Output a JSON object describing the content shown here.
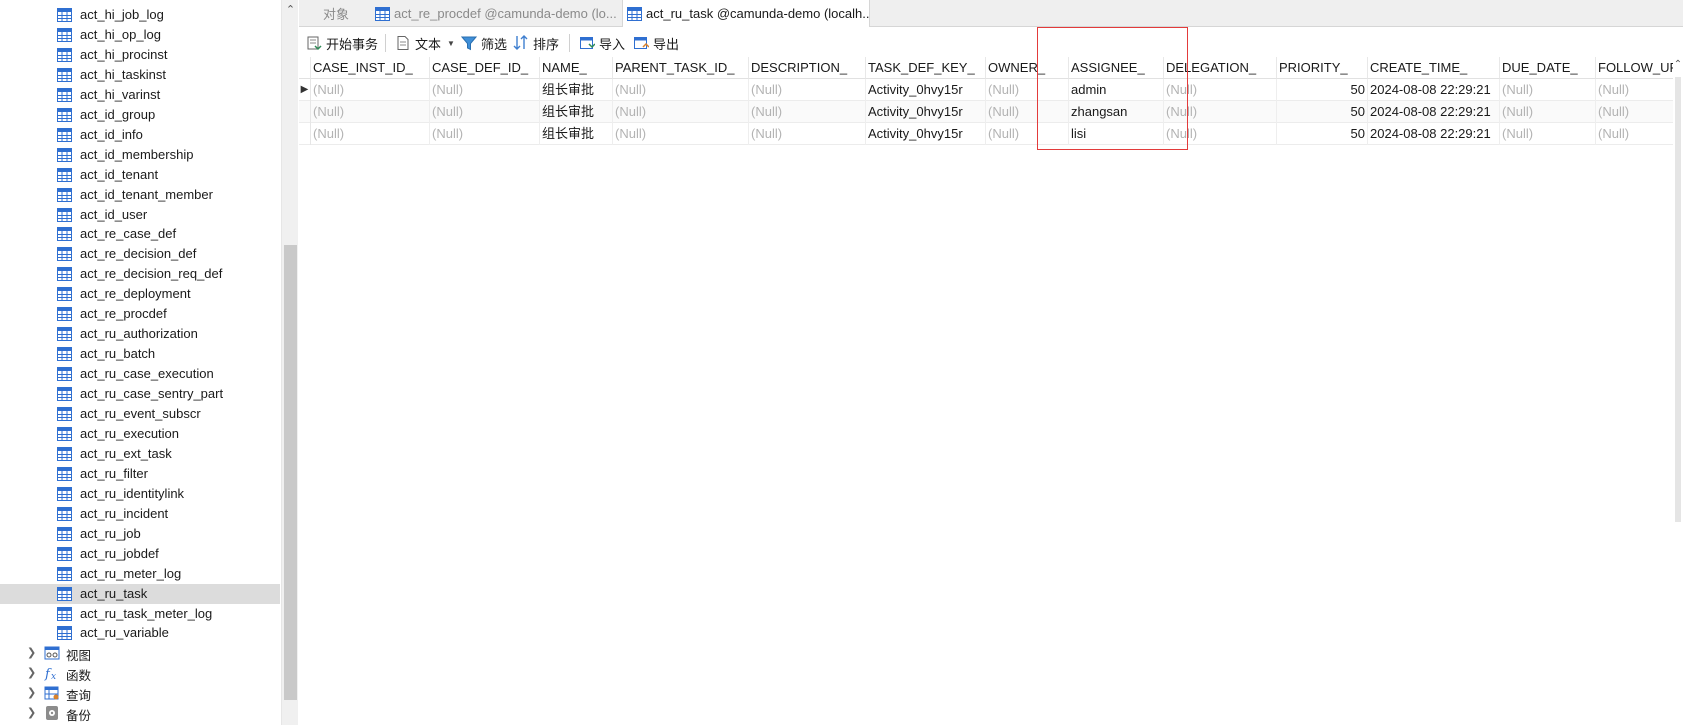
{
  "sidebar": {
    "tables": [
      {
        "label": "act_hi_job_log"
      },
      {
        "label": "act_hi_op_log"
      },
      {
        "label": "act_hi_procinst"
      },
      {
        "label": "act_hi_taskinst"
      },
      {
        "label": "act_hi_varinst"
      },
      {
        "label": "act_id_group"
      },
      {
        "label": "act_id_info"
      },
      {
        "label": "act_id_membership"
      },
      {
        "label": "act_id_tenant"
      },
      {
        "label": "act_id_tenant_member"
      },
      {
        "label": "act_id_user"
      },
      {
        "label": "act_re_case_def"
      },
      {
        "label": "act_re_decision_def"
      },
      {
        "label": "act_re_decision_req_def"
      },
      {
        "label": "act_re_deployment"
      },
      {
        "label": "act_re_procdef"
      },
      {
        "label": "act_ru_authorization"
      },
      {
        "label": "act_ru_batch"
      },
      {
        "label": "act_ru_case_execution"
      },
      {
        "label": "act_ru_case_sentry_part"
      },
      {
        "label": "act_ru_event_subscr"
      },
      {
        "label": "act_ru_execution"
      },
      {
        "label": "act_ru_ext_task"
      },
      {
        "label": "act_ru_filter"
      },
      {
        "label": "act_ru_identitylink"
      },
      {
        "label": "act_ru_incident"
      },
      {
        "label": "act_ru_job"
      },
      {
        "label": "act_ru_jobdef"
      },
      {
        "label": "act_ru_meter_log"
      },
      {
        "label": "act_ru_task",
        "selected": true
      },
      {
        "label": "act_ru_task_meter_log"
      },
      {
        "label": "act_ru_variable"
      }
    ],
    "groups": [
      {
        "label": "视图",
        "icon": "view-icon"
      },
      {
        "label": "函数",
        "icon": "function-icon"
      },
      {
        "label": "查询",
        "icon": "query-icon"
      },
      {
        "label": "备份",
        "icon": "backup-icon"
      }
    ]
  },
  "tabs": [
    {
      "label": "对象",
      "icon": null
    },
    {
      "label": "act_re_procdef @camunda-demo (lo...",
      "icon": "table-icon"
    },
    {
      "label": "act_ru_task @camunda-demo (localh...",
      "icon": "table-icon",
      "active": true
    }
  ],
  "toolbar": {
    "begin_transaction": "开始事务",
    "text": "文本",
    "filter": "筛选",
    "sort": "排序",
    "import": "导入",
    "export": "导出"
  },
  "grid": {
    "columns": [
      "CASE_INST_ID_",
      "CASE_DEF_ID_",
      "NAME_",
      "PARENT_TASK_ID_",
      "DESCRIPTION_",
      "TASK_DEF_KEY_",
      "OWNER_",
      "ASSIGNEE_",
      "DELEGATION_",
      "PRIORITY_",
      "CREATE_TIME_",
      "DUE_DATE_",
      "FOLLOW_UP_"
    ],
    "rows": [
      [
        "(Null)",
        "(Null)",
        "组长审批",
        "(Null)",
        "(Null)",
        "Activity_0hvy15r",
        "(Null)",
        "admin",
        "(Null)",
        "50",
        "2024-08-08 22:29:21",
        "(Null)",
        "(Null)"
      ],
      [
        "(Null)",
        "(Null)",
        "组长审批",
        "(Null)",
        "(Null)",
        "Activity_0hvy15r",
        "(Null)",
        "zhangsan",
        "(Null)",
        "50",
        "2024-08-08 22:29:21",
        "(Null)",
        "(Null)"
      ],
      [
        "(Null)",
        "(Null)",
        "组长审批",
        "(Null)",
        "(Null)",
        "Activity_0hvy15r",
        "(Null)",
        "lisi",
        "(Null)",
        "50",
        "2024-08-08 22:29:21",
        "(Null)",
        "(Null)"
      ]
    ],
    "current_row": 0
  },
  "colors": {
    "highlight": "#e33b3b",
    "null_text": "#b3b3b3",
    "table_icon": "#2f6fd1",
    "selected_row": "#dcdcdc"
  }
}
